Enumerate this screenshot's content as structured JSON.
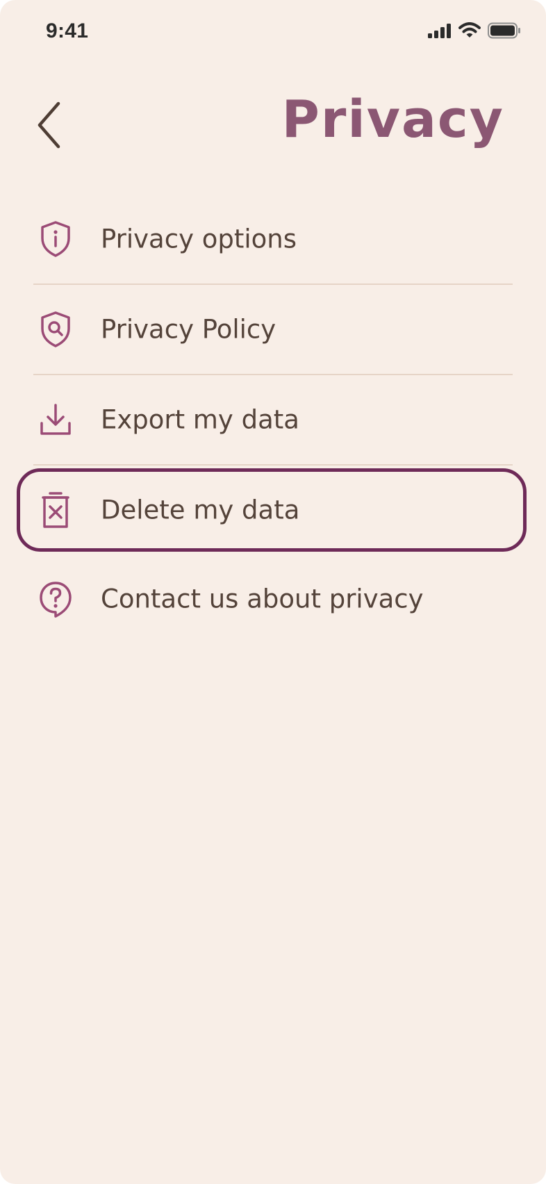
{
  "status_bar": {
    "time": "9:41",
    "icons": [
      "cellular-signal-icon",
      "wifi-icon",
      "battery-icon"
    ]
  },
  "header": {
    "back_icon": "chevron-left-icon",
    "title": "Privacy"
  },
  "menu": {
    "items": [
      {
        "label": "Privacy options",
        "icon": "shield-info-icon",
        "selected": false
      },
      {
        "label": "Privacy Policy",
        "icon": "shield-search-icon",
        "selected": false
      },
      {
        "label": "Export my data",
        "icon": "download-icon",
        "selected": false
      },
      {
        "label": "Delete my data",
        "icon": "trash-x-icon",
        "selected": true
      },
      {
        "label": "Contact us about privacy",
        "icon": "question-bubble-icon",
        "selected": false
      }
    ]
  },
  "colors": {
    "background": "#f8eee7",
    "accent": "#8b5773",
    "icon": "#9b4b76",
    "text": "#54433a",
    "divider": "#e6d4c7",
    "selection_outline": "#6e2a58"
  }
}
